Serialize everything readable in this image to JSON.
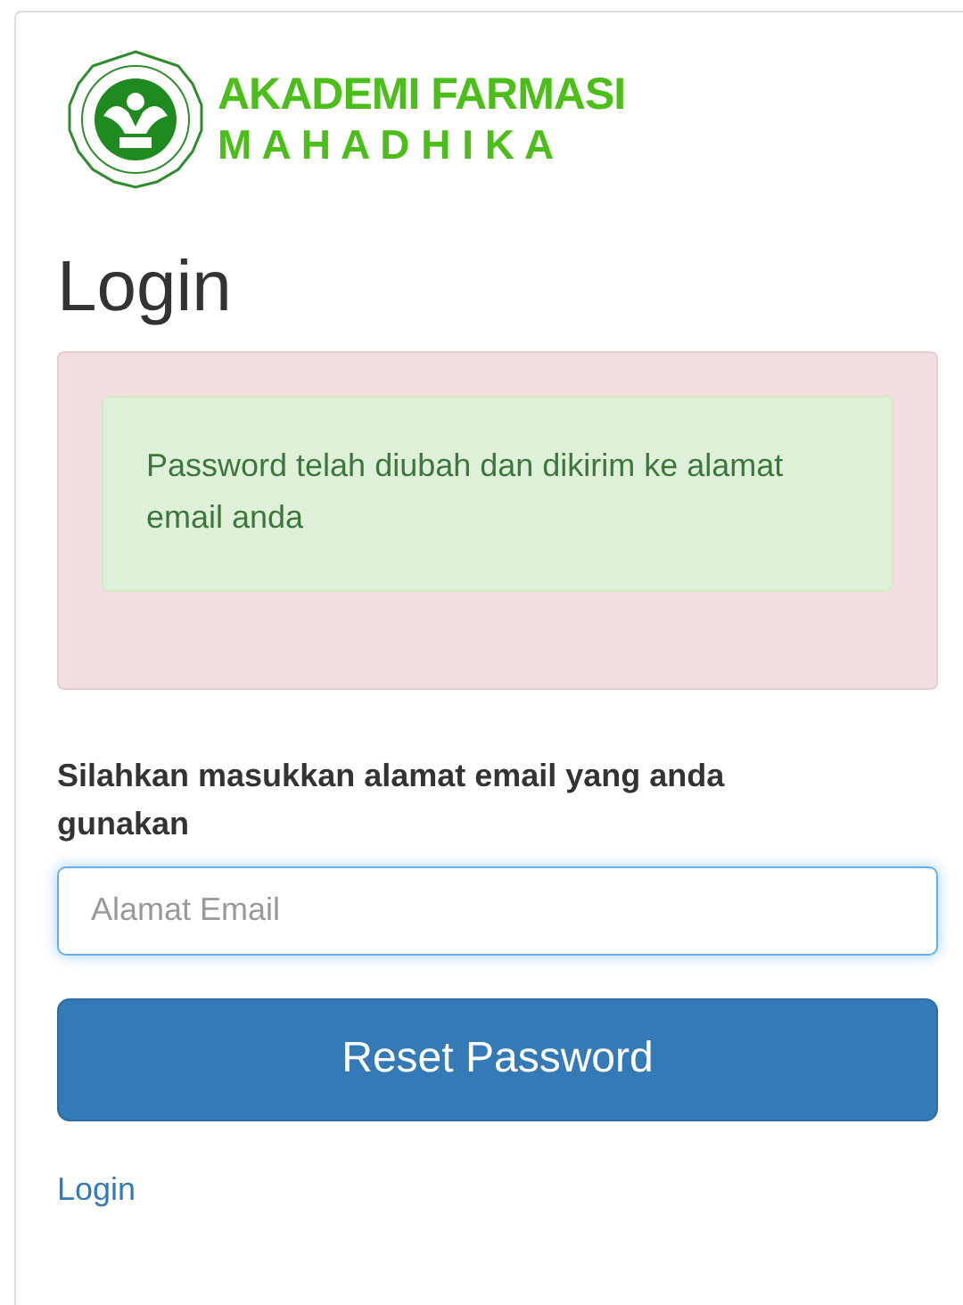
{
  "logo": {
    "line_1": "AKADEMI FARMASI",
    "line_2": "M A H A D H I K A"
  },
  "title": "Login",
  "alert": {
    "message": "Password telah diubah dan dikirim ke alamat email anda"
  },
  "form": {
    "label": "Silahkan masukkan alamat email yang anda gunakan",
    "email": {
      "placeholder": "Alamat Email",
      "focused": true
    },
    "submit": "Reset Password"
  },
  "link": "Login"
}
